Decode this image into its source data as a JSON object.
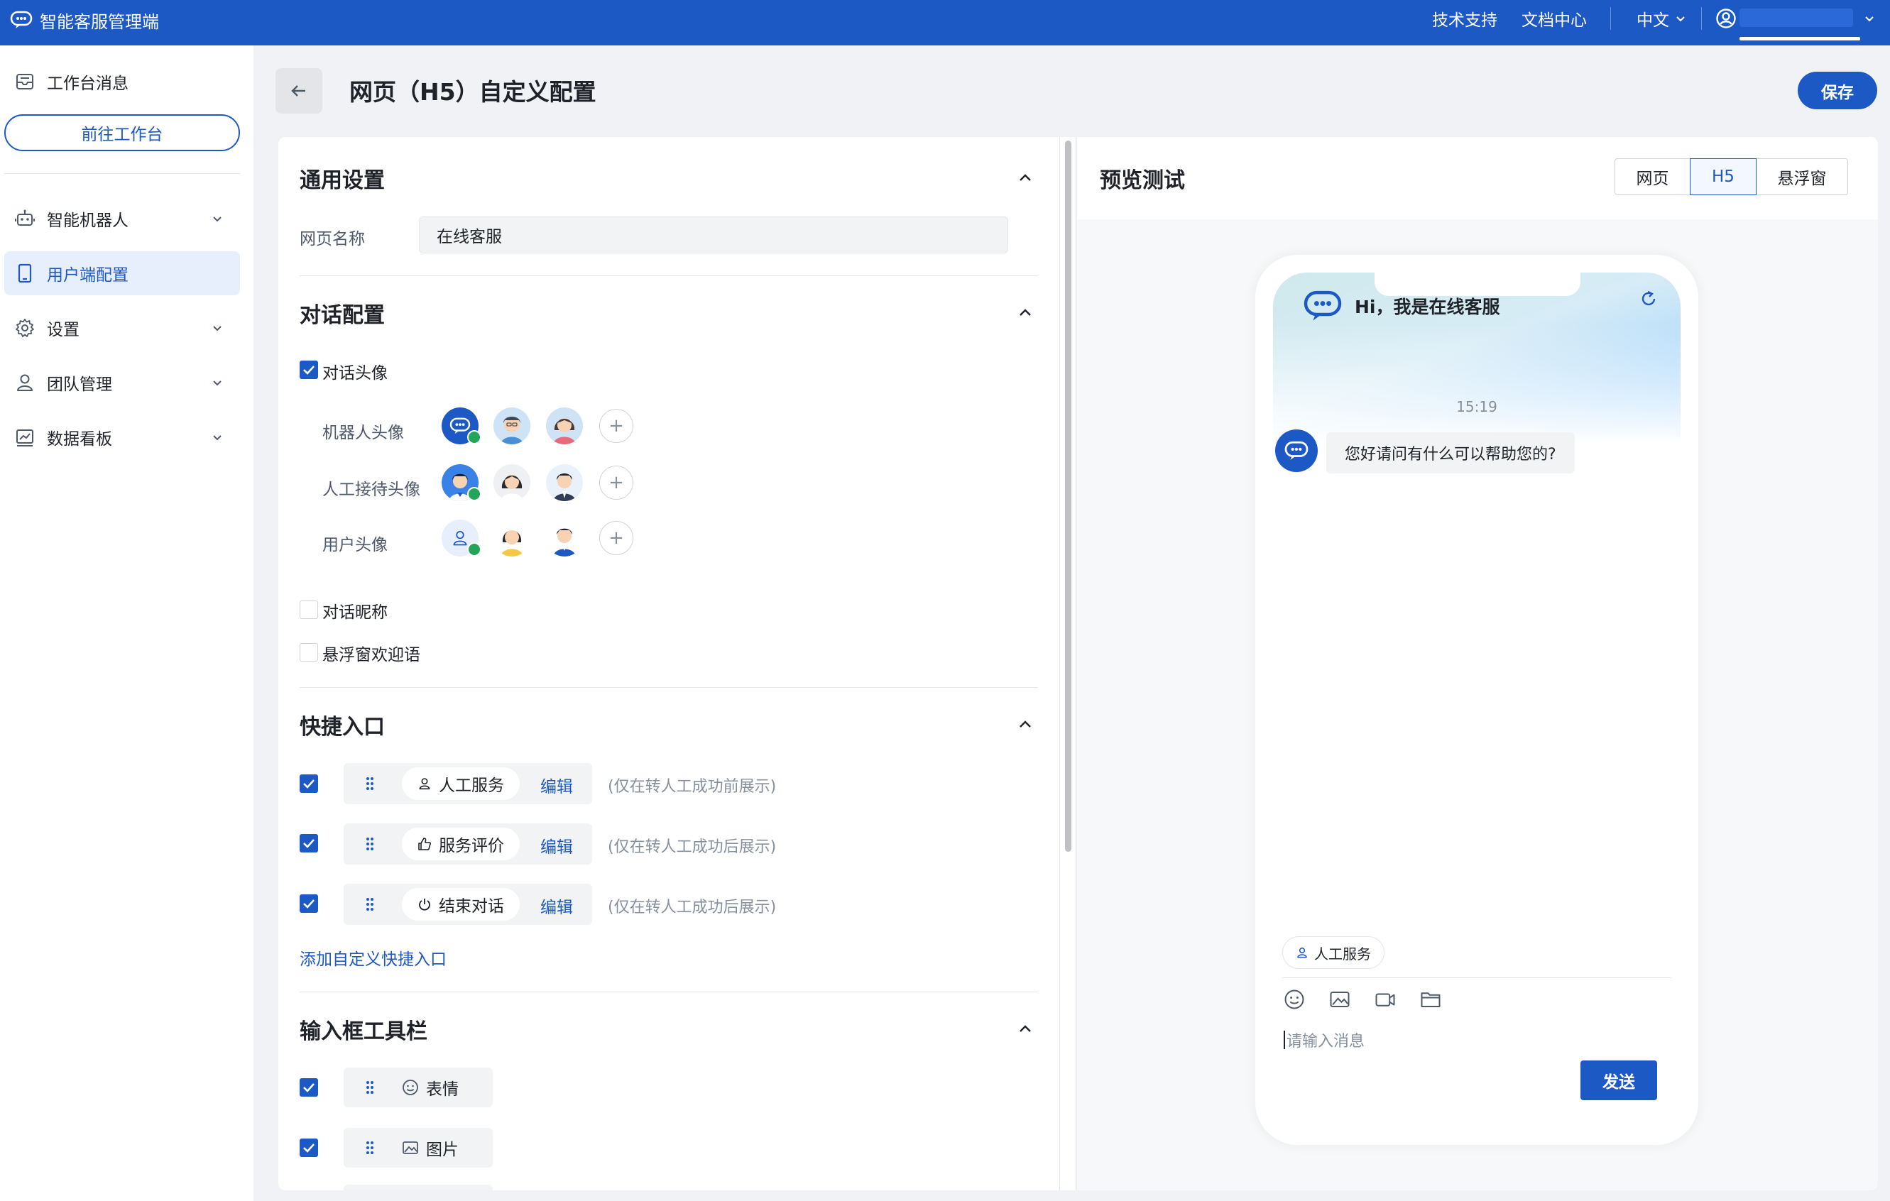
{
  "topbar": {
    "app_title": "智能客服管理端",
    "tech_support": "技术支持",
    "docs_center": "文档中心",
    "language": "中文"
  },
  "sidebar": {
    "workbench_messages": "工作台消息",
    "go_workbench": "前往工作台",
    "items": [
      {
        "label": "智能机器人",
        "icon": "robot-icon",
        "expandable": true
      },
      {
        "label": "用户端配置",
        "icon": "tablet-icon",
        "active": true
      },
      {
        "label": "设置",
        "icon": "gear-icon",
        "expandable": true
      },
      {
        "label": "团队管理",
        "icon": "user-icon",
        "expandable": true
      },
      {
        "label": "数据看板",
        "icon": "chart-icon",
        "expandable": true
      }
    ]
  },
  "page": {
    "title": "网页（H5）自定义配置",
    "save_label": "保存"
  },
  "general": {
    "heading": "通用设置",
    "page_name_label": "网页名称",
    "page_name_value": "在线客服"
  },
  "dialog": {
    "heading": "对话配置",
    "avatar_toggle": "对话头像",
    "robot_avatar_label": "机器人头像",
    "agent_avatar_label": "人工接待头像",
    "user_avatar_label": "用户头像",
    "nickname_toggle": "对话昵称",
    "float_welcome_toggle": "悬浮窗欢迎语"
  },
  "quick": {
    "heading": "快捷入口",
    "edit_label": "编辑",
    "items": [
      {
        "label": "人工服务",
        "note": "(仅在转人工成功前展示)",
        "icon": "user-icon"
      },
      {
        "label": "服务评价",
        "note": "(仅在转人工成功后展示)",
        "icon": "thumbs-up-icon"
      },
      {
        "label": "结束对话",
        "note": "(仅在转人工成功后展示)",
        "icon": "power-icon"
      }
    ],
    "add_custom": "添加自定义快捷入口"
  },
  "toolbar_section": {
    "heading": "输入框工具栏",
    "items": [
      {
        "label": "表情",
        "icon": "smile-icon"
      },
      {
        "label": "图片",
        "icon": "image-icon"
      }
    ]
  },
  "preview": {
    "heading": "预览测试",
    "tabs": [
      "网页",
      "H5",
      "悬浮窗"
    ],
    "active_tab": "H5",
    "greeting": "Hi，我是在线客服",
    "time": "15:19",
    "bot_message": "您好请问有什么可以帮助您的?",
    "quick_chip": "人工服务",
    "input_placeholder": "请输入消息",
    "send_label": "发送"
  },
  "colors": {
    "primary": "#1d59c4",
    "success": "#22a559"
  }
}
